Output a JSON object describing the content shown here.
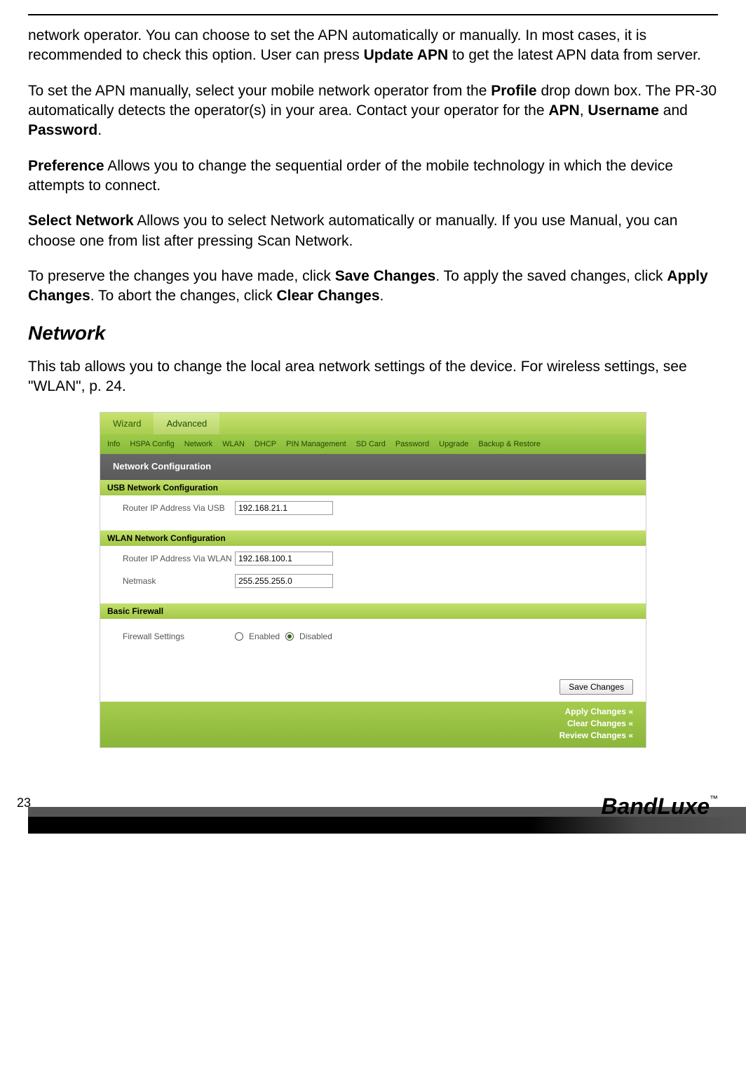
{
  "paragraphs": {
    "p1_a": "network operator. You can choose to set the APN automatically or manually. In most cases, it is recommended to check this option. User can press ",
    "p1_b": "Update APN",
    "p1_c": " to get the latest APN data from server.",
    "p2_a": "To set the APN manually, select your mobile network operator from the ",
    "p2_b": "Profile",
    "p2_c": " drop down box. The PR-30 automatically detects the operator(s) in your area. Contact your operator for the ",
    "p2_d": "APN",
    "p2_e": ", ",
    "p2_f": "Username",
    "p2_g": " and ",
    "p2_h": "Password",
    "p2_i": ".",
    "p3_a": "Preference",
    "p3_b": " Allows you to change the sequential order of the mobile technology in which the device attempts to connect.",
    "p4_a": "Select Network",
    "p4_b": " Allows you to select Network automatically or manually. If you use Manual, you can choose one from list after pressing Scan Network.",
    "p5_a": "To preserve the changes you have made, click ",
    "p5_b": "Save Changes",
    "p5_c": ". To apply the saved changes, click ",
    "p5_d": "Apply Changes",
    "p5_e": ". To abort the changes, click ",
    "p5_f": "Clear Changes",
    "p5_g": "."
  },
  "section_heading": "Network",
  "section_body": "This tab allows you to change the local area network settings of the device. For wireless settings, see \"WLAN\", p. 24.",
  "ui": {
    "tabs_top": {
      "wizard": "Wizard",
      "advanced": "Advanced"
    },
    "subtabs": {
      "info": "Info",
      "hspa": "HSPA Config",
      "network": "Network",
      "wlan": "WLAN",
      "dhcp": "DHCP",
      "pin": "PIN Management",
      "sd": "SD Card",
      "password": "Password",
      "upgrade": "Upgrade",
      "backup": "Backup & Restore"
    },
    "panel_title": "Network Configuration",
    "usb_section": "USB Network Configuration",
    "usb_label": "Router IP Address Via USB",
    "usb_value": "192.168.21.1",
    "wlan_section": "WLAN Network Configuration",
    "wlan_label": "Router IP Address Via WLAN",
    "wlan_value": "192.168.100.1",
    "netmask_label": "Netmask",
    "netmask_value": "255.255.255.0",
    "fw_section": "Basic Firewall",
    "fw_label": "Firewall Settings",
    "fw_enabled": "Enabled",
    "fw_disabled": "Disabled",
    "save_btn": "Save Changes",
    "apply": "Apply Changes «",
    "clear": "Clear Changes «",
    "review": "Review Changes «"
  },
  "page_number": "23",
  "logo_text": "BandLuxe",
  "logo_tm": "™"
}
